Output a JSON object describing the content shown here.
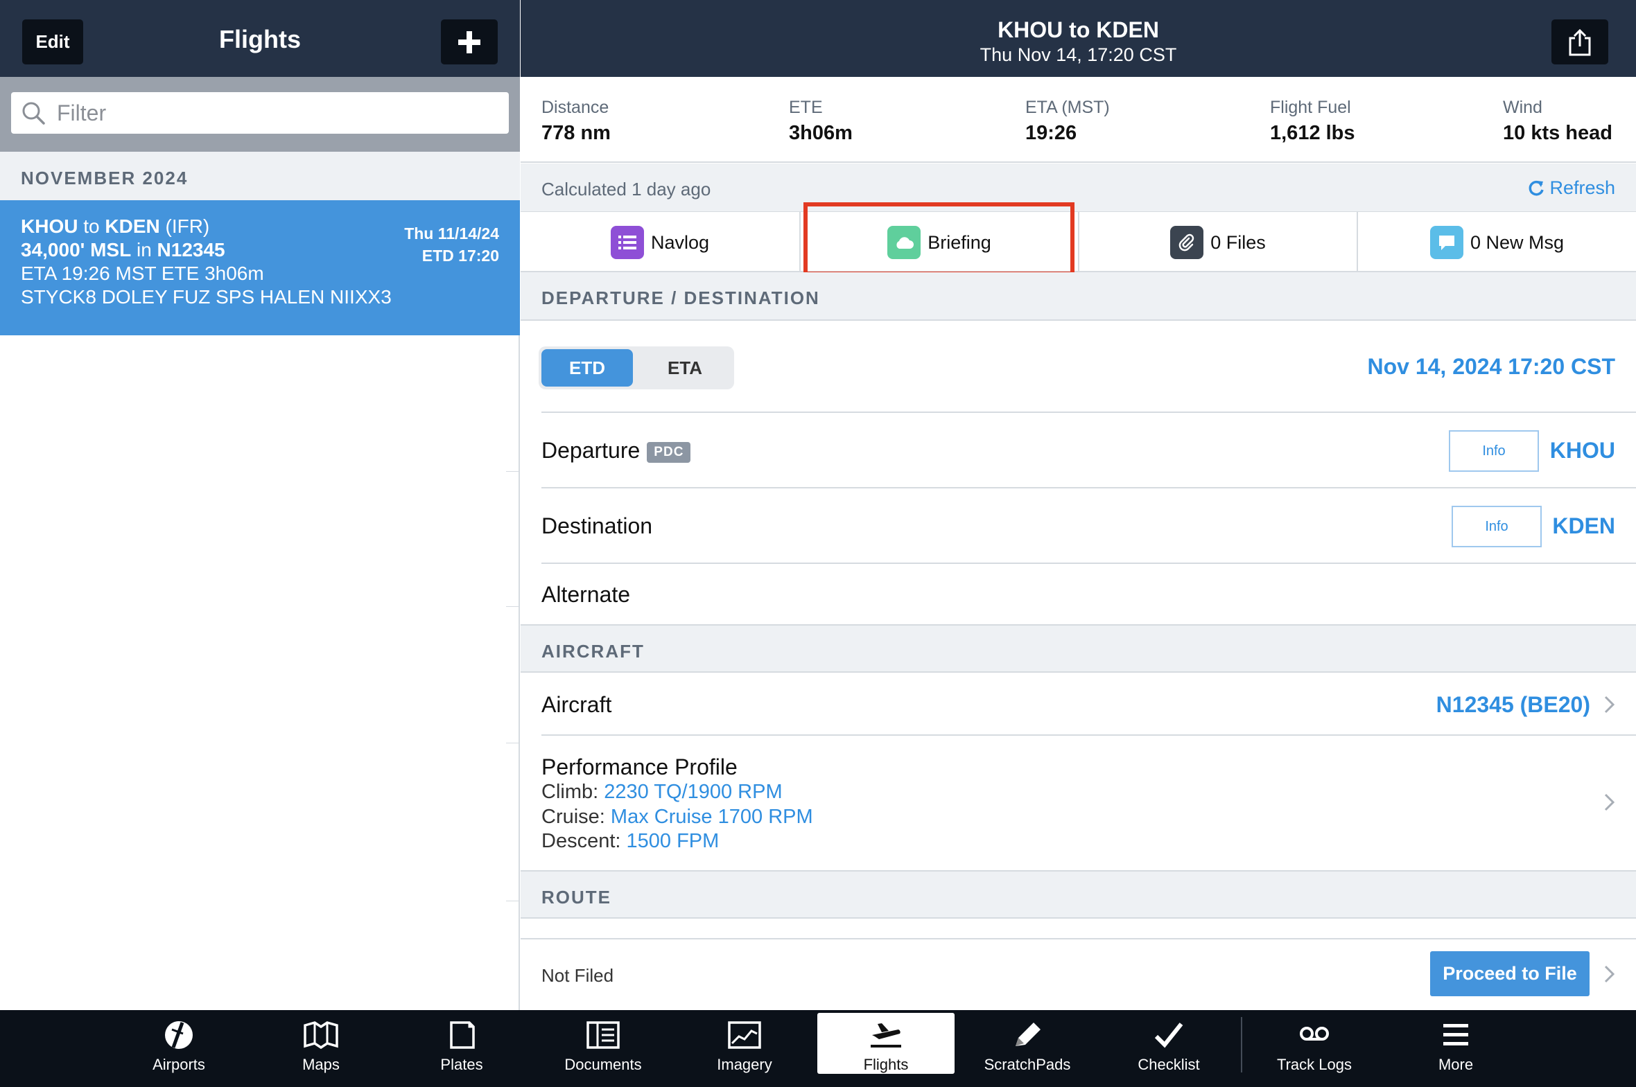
{
  "left": {
    "edit_label": "Edit",
    "title": "Flights",
    "add_label": "+",
    "search_placeholder": "Filter",
    "section_header": "NOVEMBER 2024",
    "flight": {
      "from": "KHOU",
      "to_word": "to",
      "to": "KDEN",
      "rules": "(IFR)",
      "altitude": "34,000' MSL",
      "in_word": "in",
      "tail": "N12345",
      "eta_ete": "ETA 19:26 MST ETE 3h06m",
      "route": "STYCK8 DOLEY FUZ SPS HALEN NIIXX3",
      "date": "Thu 11/14/24",
      "etd": "ETD 17:20"
    }
  },
  "header": {
    "title": "KHOU to KDEN",
    "subtitle": "Thu Nov 14, 17:20 CST"
  },
  "stats": [
    {
      "label": "Distance",
      "value": "778 nm"
    },
    {
      "label": "ETE",
      "value": "3h06m"
    },
    {
      "label": "ETA (MST)",
      "value": "19:26"
    },
    {
      "label": "Flight Fuel",
      "value": "1,612 lbs"
    },
    {
      "label": "Wind",
      "value": "10 kts head"
    }
  ],
  "calc": {
    "text": "Calculated 1 day ago",
    "refresh_label": "Refresh"
  },
  "tabs": [
    {
      "label": "Navlog",
      "icon": "list-icon",
      "color": "#8e4fd6"
    },
    {
      "label": "Briefing",
      "icon": "cloud-icon",
      "color": "#5fcf9c"
    },
    {
      "label": "0 Files",
      "icon": "paperclip-icon",
      "color": "#3b4450"
    },
    {
      "label": "0 New Msg",
      "icon": "message-icon",
      "color": "#5bbde8"
    }
  ],
  "sections": {
    "dep_dest": "DEPARTURE / DESTINATION",
    "aircraft": "AIRCRAFT",
    "route": "ROUTE"
  },
  "timing": {
    "etd_label": "ETD",
    "eta_label": "ETA",
    "value": "Nov 14, 2024 17:20 CST"
  },
  "departure": {
    "label": "Departure",
    "badge": "PDC",
    "info_label": "Info",
    "airport": "KHOU"
  },
  "destination": {
    "label": "Destination",
    "info_label": "Info",
    "airport": "KDEN"
  },
  "alternate": {
    "label": "Alternate"
  },
  "aircraft": {
    "label": "Aircraft",
    "value": "N12345 (BE20)"
  },
  "performance": {
    "title": "Performance Profile",
    "climb_label": "Climb:",
    "climb_value": "2230 TQ/1900 RPM",
    "cruise_label": "Cruise:",
    "cruise_value": "Max Cruise 1700 RPM",
    "descent_label": "Descent:",
    "descent_value": "1500 FPM"
  },
  "filing": {
    "status": "Not Filed",
    "button": "Proceed to File"
  },
  "tabbar": [
    {
      "label": "Airports",
      "icon": "airports-icon"
    },
    {
      "label": "Maps",
      "icon": "maps-icon"
    },
    {
      "label": "Plates",
      "icon": "plates-icon"
    },
    {
      "label": "Documents",
      "icon": "documents-icon"
    },
    {
      "label": "Imagery",
      "icon": "imagery-icon"
    },
    {
      "label": "Flights",
      "icon": "flights-icon",
      "selected": true
    },
    {
      "label": "ScratchPads",
      "icon": "scratchpads-icon"
    },
    {
      "label": "Checklist",
      "icon": "checklist-icon"
    },
    {
      "label": "Track Logs",
      "icon": "track-logs-icon"
    },
    {
      "label": "More",
      "icon": "more-icon"
    }
  ],
  "colors": {
    "header_bg": "#253246",
    "accent_blue": "#2f8ee0",
    "selected_row": "#4494dc",
    "highlight_red": "#e23a22",
    "tabbar_bg": "#0b1119"
  }
}
